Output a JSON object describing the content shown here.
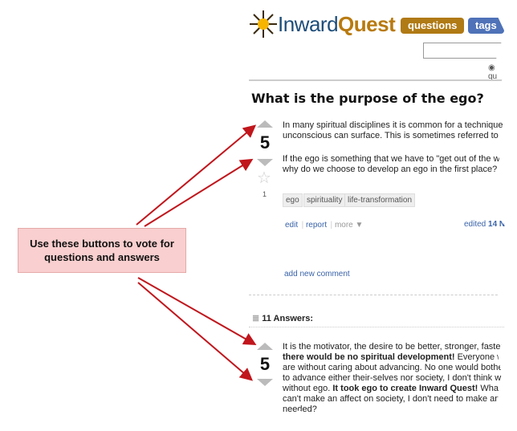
{
  "header": {
    "logo_a": "Inward",
    "logo_b": "Quest",
    "nav": [
      {
        "label": "questions",
        "color": "#b07a14"
      },
      {
        "label": "tags",
        "color": "#4f72b8"
      }
    ],
    "radio_label": "qu"
  },
  "question": {
    "title": "What is the purpose of the ego?",
    "votes": "5",
    "favorites": "1",
    "body": [
      "In many spiritual disciplines it is common for a technique",
      "unconscious can surface. This is sometimes referred to",
      "If the ego is something that we have to \"get out of the wa",
      "why do we choose to develop an ego in the first place?"
    ],
    "tags": [
      "ego",
      "spirituality",
      "life-transformation"
    ],
    "actions": {
      "edit": "edit",
      "report": "report",
      "more": "more ▼"
    },
    "edited_prefix": "edited",
    "edited_date": "14 N",
    "add_comment": "add new comment"
  },
  "answers": {
    "heading": "11 Answers:",
    "first": {
      "votes": "5",
      "lines": [
        [
          "It is the motivator, the desire to be better, stronger, faster",
          ""
        ],
        [
          "there would be no spiritual development!",
          " Everyone w"
        ],
        [
          "are without caring about advancing. No one would bother",
          ""
        ],
        [
          "to advance either their-selves nor society, I don't think w",
          ""
        ],
        [
          "without ego. ",
          "It took ego to create Inward Quest!",
          " Wha"
        ],
        [
          "can't make an affect on society, I don't need to make an i",
          ""
        ],
        [
          "needed?",
          ""
        ]
      ]
    }
  },
  "callout": {
    "text": "Use these buttons to vote for questions and answers",
    "background": "#f9cfcf",
    "arrow_color": "#c0161c"
  }
}
